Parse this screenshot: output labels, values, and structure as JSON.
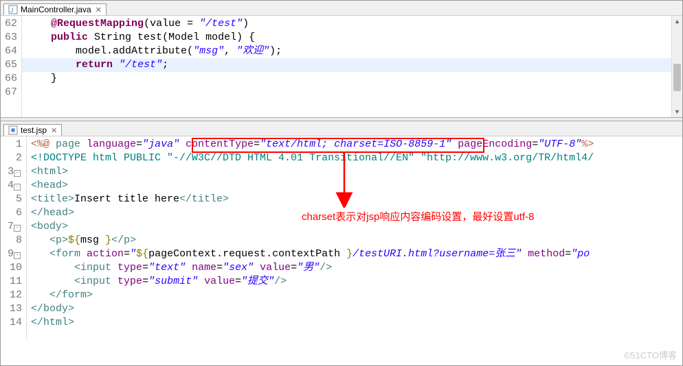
{
  "editor1": {
    "tab_label": "MainController.java",
    "lines": [
      {
        "num": "62",
        "html": "    <span class='kw'>@RequestMapping</span>(value = <span class='str'>\"/test\"</span>)"
      },
      {
        "num": "63",
        "html": "    <span class='kw'>public</span> String test(Model model) {"
      },
      {
        "num": "64",
        "html": "        model.addAttribute(<span class='str'>\"msg\"</span>, <span class='str'>\"欢迎\"</span>);"
      },
      {
        "num": "65",
        "html": "        <span class='kw'>return</span> <span class='str'>\"/test\"</span>;",
        "hl": true
      },
      {
        "num": "66",
        "html": "    }"
      },
      {
        "num": "67",
        "html": ""
      }
    ]
  },
  "editor2": {
    "tab_label": "test.jsp",
    "lines": [
      {
        "num": "1",
        "html": "<span class='jsp-dir'>&lt;%@</span> <span class='tag'>page</span> <span class='attr'>language</span>=<span class='attr-val'>\"java\"</span> <span class='attr'>contentType</span>=<span class='attr-val'>\"text/html; charset=ISO-8859-1\"</span> <span class='attr'>pageEncoding</span>=<span class='attr-val'>\"UTF-8\"</span><span class='jsp-dir'>%&gt;</span>"
      },
      {
        "num": "2",
        "html": "<span class='doctype'>&lt;!DOCTYPE html PUBLIC \"-//W3C//DTD HTML 4.01 Transitional//EN\" \"http://www.w3.org/TR/html4/</span>"
      },
      {
        "num": "3",
        "fold": true,
        "html": "<span class='tag'>&lt;html&gt;</span>"
      },
      {
        "num": "4",
        "fold": true,
        "html": "<span class='tag'>&lt;head&gt;</span>"
      },
      {
        "num": "5",
        "html": "<span class='tag'>&lt;title&gt;</span>Insert title here<span class='tag'>&lt;/title&gt;</span>"
      },
      {
        "num": "6",
        "html": "<span class='tag'>&lt;/head&gt;</span>"
      },
      {
        "num": "7",
        "fold": true,
        "html": "<span class='tag'>&lt;body&gt;</span>"
      },
      {
        "num": "8",
        "html": "   <span class='tag'>&lt;p&gt;</span><span class='el'>${</span>msg <span class='el'>}</span><span class='tag'>&lt;/p&gt;</span>"
      },
      {
        "num": "9",
        "fold": true,
        "html": "   <span class='tag'>&lt;form</span> <span class='attr'>action</span>=<span class='attr-val'>\"</span><span class='el'>${</span>pageContext.request.contextPath <span class='el'>}</span><span class='attr-val'>/testURI.html?username=张三\"</span> <span class='attr'>method</span>=<span class='attr-val'>\"po</span>"
      },
      {
        "num": "10",
        "html": "       <span class='tag'>&lt;input</span> <span class='attr'>type</span>=<span class='attr-val'>\"text\"</span> <span class='attr'>name</span>=<span class='attr-val'>\"sex\"</span> <span class='attr'>value</span>=<span class='attr-val'>\"男\"</span><span class='tag'>/&gt;</span>"
      },
      {
        "num": "11",
        "html": "       <span class='tag'>&lt;input</span> <span class='attr'>type</span>=<span class='attr-val'>\"submit\"</span> <span class='attr'>value</span>=<span class='attr-val'>\"提交\"</span><span class='tag'>/&gt;</span>"
      },
      {
        "num": "12",
        "html": "   <span class='tag'>&lt;/form&gt;</span>"
      },
      {
        "num": "13",
        "html": "<span class='tag'>&lt;/body&gt;</span>"
      },
      {
        "num": "14",
        "html": "<span class='tag'>&lt;/html&gt;</span>"
      }
    ]
  },
  "annotation_text": "charset表示对jsp响应内容编码设置，最好设置utf-8",
  "watermark": "©51CTO博客"
}
